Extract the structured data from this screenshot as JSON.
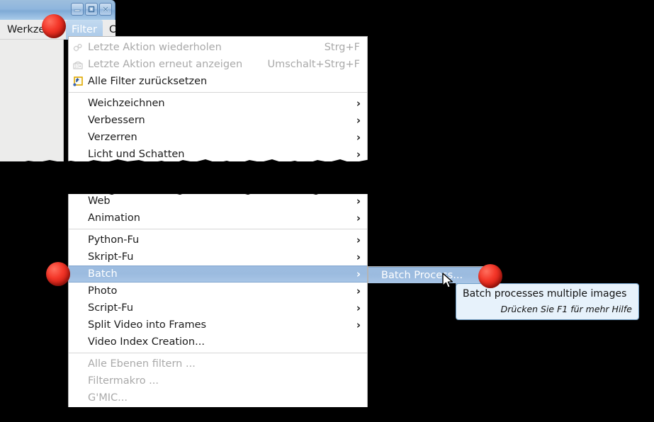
{
  "window": {
    "title_buttons": [
      {
        "name": "minimize",
        "glyph": "minimize-icon"
      },
      {
        "name": "maximize",
        "glyph": "maximize-icon"
      },
      {
        "name": "close",
        "glyph": "close-icon"
      }
    ]
  },
  "menubar": {
    "items": [
      {
        "label": "Werkzeuge",
        "selected": false
      },
      {
        "label": "Filter",
        "selected": true
      },
      {
        "label": "C",
        "selected": false
      }
    ]
  },
  "filter_menu": {
    "groups": [
      {
        "items": [
          {
            "label": "Letzte Aktion wiederholen",
            "accel": "Strg+F",
            "disabled": true,
            "submenu": false,
            "icon": "repeat-action-icon"
          },
          {
            "label": "Letzte Aktion erneut anzeigen",
            "accel": "Umschalt+Strg+F",
            "disabled": true,
            "submenu": false,
            "icon": "reshow-action-icon"
          },
          {
            "label": "Alle Filter zurücksetzen",
            "accel": "",
            "disabled": false,
            "submenu": false,
            "icon": "reset-filters-icon"
          }
        ]
      },
      {
        "items": [
          {
            "label": "Weichzeichnen",
            "accel": "",
            "disabled": false,
            "submenu": true,
            "icon": ""
          },
          {
            "label": "Verbessern",
            "accel": "",
            "disabled": false,
            "submenu": true,
            "icon": ""
          },
          {
            "label": "Verzerren",
            "accel": "",
            "disabled": false,
            "submenu": true,
            "icon": ""
          },
          {
            "label": "Licht und Schatten",
            "accel": "",
            "disabled": false,
            "submenu": true,
            "icon": ""
          }
        ]
      }
    ],
    "groups2": [
      {
        "items": [
          {
            "label": "Web",
            "accel": "",
            "disabled": false,
            "submenu": true,
            "icon": ""
          },
          {
            "label": "Animation",
            "accel": "",
            "disabled": false,
            "submenu": true,
            "icon": ""
          }
        ]
      },
      {
        "items": [
          {
            "label": "Python-Fu",
            "accel": "",
            "disabled": false,
            "submenu": true,
            "icon": "",
            "selected": false
          },
          {
            "label": "Skript-Fu",
            "accel": "",
            "disabled": false,
            "submenu": true,
            "icon": "",
            "selected": false
          },
          {
            "label": "Batch",
            "accel": "",
            "disabled": false,
            "submenu": true,
            "icon": "",
            "selected": true
          },
          {
            "label": "Photo",
            "accel": "",
            "disabled": false,
            "submenu": true,
            "icon": "",
            "selected": false
          },
          {
            "label": "Script-Fu",
            "accel": "",
            "disabled": false,
            "submenu": true,
            "icon": "",
            "selected": false
          },
          {
            "label": "Split Video into Frames",
            "accel": "",
            "disabled": false,
            "submenu": true,
            "icon": "",
            "selected": false
          },
          {
            "label": "Video Index Creation...",
            "accel": "",
            "disabled": false,
            "submenu": false,
            "icon": "",
            "selected": false
          }
        ]
      },
      {
        "items": [
          {
            "label": "Alle Ebenen filtern ...",
            "accel": "",
            "disabled": true,
            "submenu": false,
            "icon": ""
          },
          {
            "label": "Filtermakro ...",
            "accel": "",
            "disabled": true,
            "submenu": false,
            "icon": ""
          },
          {
            "label": "G'MIC...",
            "accel": "",
            "disabled": true,
            "submenu": false,
            "icon": ""
          }
        ]
      }
    ]
  },
  "submenu": {
    "items": [
      {
        "label": "Batch Process...",
        "selected": true
      }
    ]
  },
  "tooltip": {
    "main": "Batch processes multiple images",
    "sub": "Drücken Sie F1 für mehr Hilfe"
  },
  "markers": {
    "count": 3,
    "color": "#e8271a"
  },
  "cursor": {
    "name": "arrow-pointer"
  },
  "colors": {
    "menu_bg": "#ffffff",
    "menu_border": "#b4b4b4",
    "highlight": "#9bbbdf",
    "highlight_text": "#ffffff",
    "disabled_text": "#a9a9a9",
    "tooltip_bg": "#e7f2fb",
    "tooltip_border": "#6f9fc8",
    "titlebar": "#8fb6dd",
    "window_bg": "#ececeb",
    "backdrop": "#000000"
  }
}
